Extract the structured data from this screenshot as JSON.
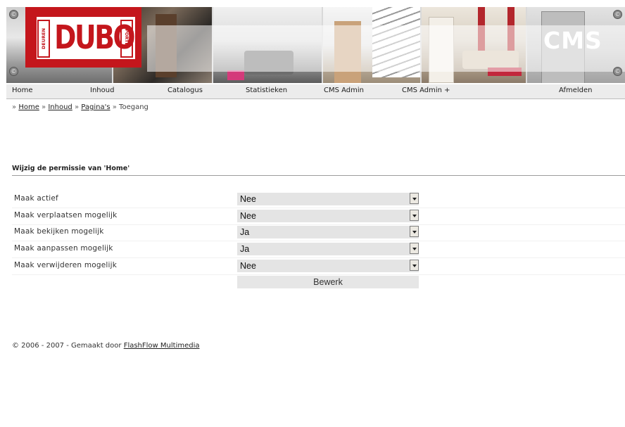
{
  "brand": {
    "logo_main": "DUBO",
    "logo_left": "DEUREN",
    "logo_right": "PORTES",
    "cms_label": "CMS",
    "logo_color": "#c4161c"
  },
  "nav": {
    "items": [
      "Home",
      "Inhoud",
      "Catalogus",
      "Statistieken",
      "CMS Admin",
      "CMS Admin +",
      "Afmelden"
    ]
  },
  "breadcrumb": {
    "prefix": "»",
    "items": [
      "Home",
      "Inhoud",
      "Pagina's"
    ],
    "current": "Toegang"
  },
  "form": {
    "title": "Wijzig de permissie van 'Home'",
    "rows": [
      {
        "label": "Maak actief",
        "value": "Nee"
      },
      {
        "label": "Maak verplaatsen mogelijk",
        "value": "Nee"
      },
      {
        "label": "Maak bekijken mogelijk",
        "value": "Ja"
      },
      {
        "label": "Maak aanpassen mogelijk",
        "value": "Ja"
      },
      {
        "label": "Maak verwijderen mogelijk",
        "value": "Nee"
      }
    ],
    "submit_label": "Bewerk"
  },
  "footer": {
    "text": "© 2006 - 2007 - Gemaakt door",
    "link": "FlashFlow Multimedia"
  }
}
